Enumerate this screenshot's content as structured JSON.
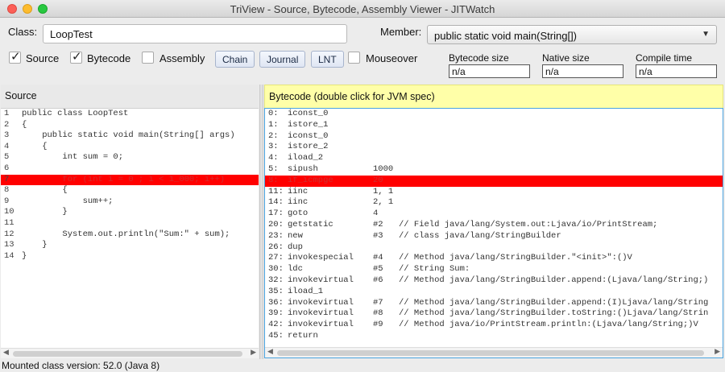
{
  "window": {
    "title": "TriView - Source, Bytecode, Assembly Viewer - JITWatch"
  },
  "toolbar": {
    "class_label": "Class:",
    "class_value": "LoopTest",
    "member_label": "Member:",
    "member_value": "public static void main(String[])",
    "checkboxes": [
      {
        "label": "Source",
        "checked": true
      },
      {
        "label": "Bytecode",
        "checked": true
      },
      {
        "label": "Assembly",
        "checked": false
      }
    ],
    "buttons": [
      "Chain",
      "Journal",
      "LNT"
    ],
    "mouseover": {
      "label": "Mouseover",
      "checked": false
    },
    "bytecode_size_label": "Bytecode size",
    "bytecode_size_value": "n/a",
    "native_size_label": "Native size",
    "native_size_value": "n/a",
    "compile_time_label": "Compile time",
    "compile_time_value": "n/a"
  },
  "source": {
    "title": "Source",
    "highlight_line": 6,
    "lines": [
      {
        "n": "1",
        "text": "public class LoopTest"
      },
      {
        "n": "2",
        "text": "{"
      },
      {
        "n": "3",
        "text": "    public static void main(String[] args)"
      },
      {
        "n": "4",
        "text": "    {"
      },
      {
        "n": "5",
        "text": "        int sum = 0;"
      },
      {
        "n": "6",
        "text": ""
      },
      {
        "n": "7",
        "text": "        for (int i = 0 ; i < 1_000; i++)"
      },
      {
        "n": "8",
        "text": "        {"
      },
      {
        "n": "9",
        "text": "            sum++;"
      },
      {
        "n": "10",
        "text": "        }"
      },
      {
        "n": "11",
        "text": ""
      },
      {
        "n": "12",
        "text": "        System.out.println(\"Sum:\" + sum);"
      },
      {
        "n": "13",
        "text": "    }"
      },
      {
        "n": "14",
        "text": "}"
      }
    ]
  },
  "bytecode": {
    "title": "Bytecode (double click for JVM spec)",
    "lines": [
      {
        "off": "0:",
        "op": "iconst_0",
        "arg": "",
        "cmt": ""
      },
      {
        "off": "1:",
        "op": "istore_1",
        "arg": "",
        "cmt": ""
      },
      {
        "off": "2:",
        "op": "iconst_0",
        "arg": "",
        "cmt": ""
      },
      {
        "off": "3:",
        "op": "istore_2",
        "arg": "",
        "cmt": ""
      },
      {
        "off": "4:",
        "op": "iload_2",
        "arg": "",
        "cmt": ""
      },
      {
        "off": "5:",
        "op": "sipush",
        "arg": "1000",
        "cmt": ""
      },
      {
        "off": "8:",
        "op": "if_icmpge",
        "arg": "20",
        "cmt": ""
      },
      {
        "off": "11:",
        "op": "iinc",
        "arg": "1, 1",
        "cmt": ""
      },
      {
        "off": "14:",
        "op": "iinc",
        "arg": "2, 1",
        "cmt": ""
      },
      {
        "off": "17:",
        "op": "goto",
        "arg": "4",
        "cmt": ""
      },
      {
        "off": "20:",
        "op": "getstatic",
        "arg": "#2",
        "cmt": "// Field java/lang/System.out:Ljava/io/PrintStream;"
      },
      {
        "off": "23:",
        "op": "new",
        "arg": "#3",
        "cmt": "// class java/lang/StringBuilder"
      },
      {
        "off": "26:",
        "op": "dup",
        "arg": "",
        "cmt": ""
      },
      {
        "off": "27:",
        "op": "invokespecial",
        "arg": "#4",
        "cmt": "// Method java/lang/StringBuilder.\"<init>\":()V"
      },
      {
        "off": "30:",
        "op": "ldc",
        "arg": "#5",
        "cmt": "// String Sum:"
      },
      {
        "off": "32:",
        "op": "invokevirtual",
        "arg": "#6",
        "cmt": "// Method java/lang/StringBuilder.append:(Ljava/lang/String;)"
      },
      {
        "off": "35:",
        "op": "iload_1",
        "arg": "",
        "cmt": ""
      },
      {
        "off": "36:",
        "op": "invokevirtual",
        "arg": "#7",
        "cmt": "// Method java/lang/StringBuilder.append:(I)Ljava/lang/String"
      },
      {
        "off": "39:",
        "op": "invokevirtual",
        "arg": "#8",
        "cmt": "// Method java/lang/StringBuilder.toString:()Ljava/lang/Strin"
      },
      {
        "off": "42:",
        "op": "invokevirtual",
        "arg": "#9",
        "cmt": "// Method java/io/PrintStream.println:(Ljava/lang/String;)V"
      },
      {
        "off": "45:",
        "op": "return",
        "arg": "",
        "cmt": ""
      }
    ],
    "highlight_index": 6
  },
  "status": {
    "text": "Mounted class version: 52.0 (Java 8)"
  },
  "colors": {
    "highlight": "#ff0000",
    "bytecode_header": "#ffffa8",
    "focus_border": "#4aa3df"
  }
}
